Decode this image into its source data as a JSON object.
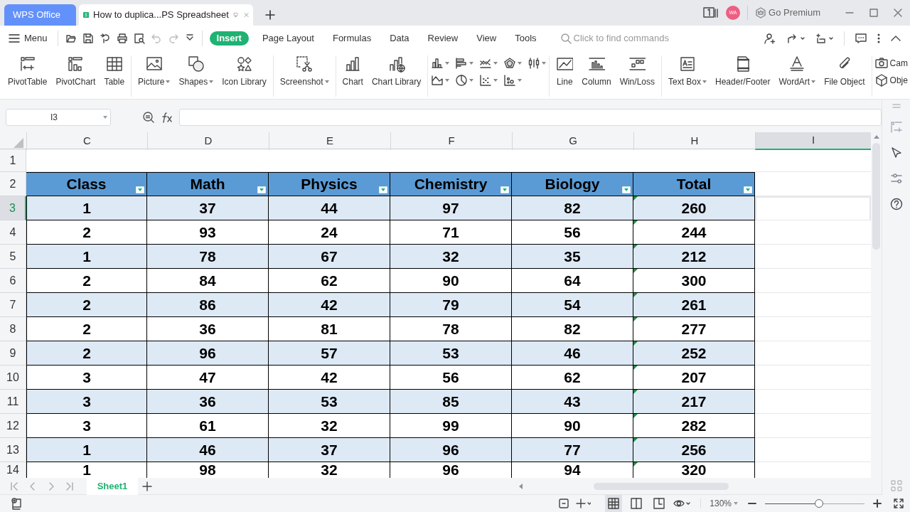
{
  "tabs": [
    {
      "label": "WPS Office",
      "kind": "home",
      "selected": false
    },
    {
      "label": "How to duplica...PS Spreadsheet",
      "kind": "document",
      "selected": true
    }
  ],
  "title_bar": {
    "avatar": "WA",
    "premium": "Go Premium"
  },
  "menu_bar": {
    "menu": "Menu",
    "tabs": [
      {
        "label": "Insert",
        "selected": true
      },
      {
        "label": "Page Layout",
        "selected": false
      },
      {
        "label": "Formulas",
        "selected": false
      },
      {
        "label": "Data",
        "selected": false
      },
      {
        "label": "Review",
        "selected": false
      },
      {
        "label": "View",
        "selected": false
      },
      {
        "label": "Tools",
        "selected": false
      }
    ],
    "search": {
      "placeholder": "Click to find commands"
    }
  },
  "ribbon": [
    {
      "kind": "large",
      "items": [
        {
          "label": "PivotTable",
          "dropdown": false
        },
        {
          "label": "PivotChart",
          "dropdown": false
        },
        {
          "label": "Table",
          "dropdown": false
        }
      ]
    },
    {
      "kind": "large",
      "items": [
        {
          "label": "Picture",
          "dropdown": true
        },
        {
          "label": "Shapes",
          "dropdown": true
        },
        {
          "label": "Icon Library",
          "dropdown": false
        }
      ]
    },
    {
      "kind": "large",
      "items": [
        {
          "label": "Screenshot",
          "dropdown": true
        }
      ]
    },
    {
      "kind": "large",
      "items": [
        {
          "label": "Chart",
          "dropdown": false
        },
        {
          "label": "Chart Library",
          "dropdown": false
        }
      ]
    },
    {
      "kind": "chart_types"
    },
    {
      "kind": "large",
      "items": [
        {
          "label": "Line",
          "dropdown": false
        },
        {
          "label": "Column",
          "dropdown": false
        },
        {
          "label": "Win/Loss",
          "dropdown": false
        }
      ]
    },
    {
      "kind": "large",
      "items": [
        {
          "label": "Text Box",
          "dropdown": true
        },
        {
          "label": "Header/Footer",
          "dropdown": false
        },
        {
          "label": "WordArt",
          "dropdown": true
        },
        {
          "label": "File Object",
          "dropdown": false
        }
      ]
    },
    {
      "kind": "small",
      "items": [
        {
          "label": "Cam"
        },
        {
          "label": "Obje"
        }
      ]
    }
  ],
  "formula_bar": {
    "name_box": "I3"
  },
  "sheet": {
    "columns": [
      {
        "label": "C",
        "selected": false
      },
      {
        "label": "D",
        "selected": false
      },
      {
        "label": "E",
        "selected": false
      },
      {
        "label": "F",
        "selected": false
      },
      {
        "label": "G",
        "selected": false
      },
      {
        "label": "H",
        "selected": false
      },
      {
        "label": "I",
        "selected": true
      }
    ],
    "header_row": {
      "number": "2",
      "cells": [
        "Class",
        "Math",
        "Physics",
        "Chemistry",
        "Biology",
        "Total"
      ]
    },
    "rows": [
      {
        "number": "1",
        "selected": false,
        "cells": []
      },
      {
        "number": "3",
        "selected": true,
        "flagged": true,
        "cells": [
          "1",
          "37",
          "44",
          "97",
          "82",
          "260"
        ]
      },
      {
        "number": "4",
        "selected": false,
        "flagged": true,
        "cells": [
          "2",
          "93",
          "24",
          "71",
          "56",
          "244"
        ]
      },
      {
        "number": "5",
        "selected": false,
        "flagged": true,
        "cells": [
          "1",
          "78",
          "67",
          "32",
          "35",
          "212"
        ]
      },
      {
        "number": "6",
        "selected": false,
        "flagged": true,
        "cells": [
          "2",
          "84",
          "62",
          "90",
          "64",
          "300"
        ]
      },
      {
        "number": "7",
        "selected": false,
        "flagged": true,
        "cells": [
          "2",
          "86",
          "42",
          "79",
          "54",
          "261"
        ]
      },
      {
        "number": "8",
        "selected": false,
        "flagged": true,
        "cells": [
          "2",
          "36",
          "81",
          "78",
          "82",
          "277"
        ]
      },
      {
        "number": "9",
        "selected": false,
        "flagged": true,
        "cells": [
          "2",
          "96",
          "57",
          "53",
          "46",
          "252"
        ]
      },
      {
        "number": "10",
        "selected": false,
        "flagged": true,
        "cells": [
          "3",
          "47",
          "42",
          "56",
          "62",
          "207"
        ]
      },
      {
        "number": "11",
        "selected": false,
        "flagged": true,
        "cells": [
          "3",
          "36",
          "53",
          "85",
          "43",
          "217"
        ]
      },
      {
        "number": "12",
        "selected": false,
        "flagged": true,
        "cells": [
          "3",
          "61",
          "32",
          "99",
          "90",
          "282"
        ]
      },
      {
        "number": "13",
        "selected": false,
        "flagged": true,
        "cells": [
          "1",
          "46",
          "37",
          "96",
          "77",
          "256"
        ]
      },
      {
        "number": "14",
        "selected": false,
        "flagged": true,
        "cells": [
          "1",
          "98",
          "32",
          "96",
          "94",
          "320"
        ]
      }
    ]
  },
  "sheet_tabs": [
    {
      "label": "Sheet1",
      "selected": true
    }
  ],
  "status_bar": {
    "views": [
      {
        "kind": "normal",
        "selected": true
      },
      {
        "kind": "page_break",
        "selected": false
      },
      {
        "kind": "page",
        "selected": false
      }
    ],
    "zoom": "130%",
    "zoom_slider": {
      "level": 0.5
    }
  }
}
